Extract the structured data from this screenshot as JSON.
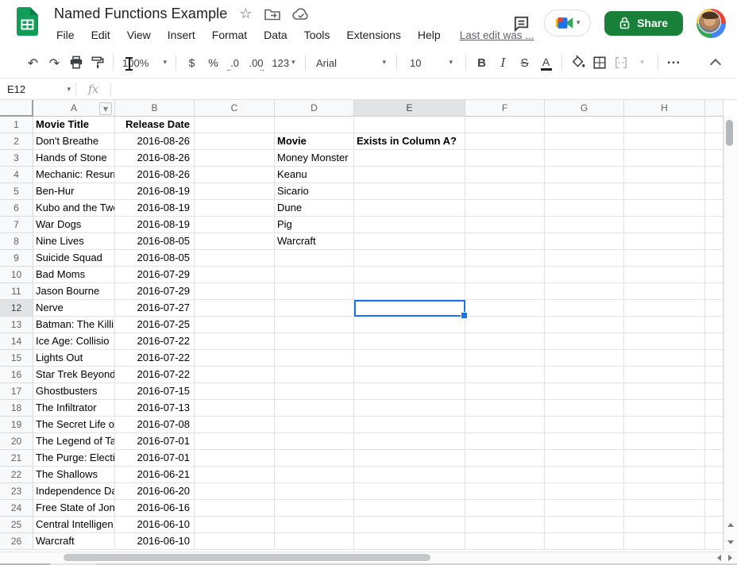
{
  "header": {
    "title": "Named Functions Example",
    "menus": [
      "File",
      "Edit",
      "View",
      "Insert",
      "Format",
      "Data",
      "Tools",
      "Extensions",
      "Help"
    ],
    "last_edit": "Last edit was ...",
    "share_label": "Share"
  },
  "toolbar": {
    "zoom": "100%",
    "currency": "$",
    "percent": "%",
    "decrease_decimal": ".0",
    "increase_decimal": ".00",
    "number_format": "123",
    "font_name": "Arial",
    "font_size": "10",
    "bold": "B",
    "italic": "I",
    "strikethrough": "S",
    "text_color": "A",
    "more": "..."
  },
  "formula_bar": {
    "name_box": "E12",
    "fx": "fx",
    "formula": ""
  },
  "icons": {
    "undo": "↶",
    "redo": "↷",
    "caret": "▾",
    "star": "☆",
    "left_arrow": "←",
    "right_arrow": "→",
    "filter_caret": "▼"
  },
  "colors": {
    "accent_blue": "#1a73e8",
    "logo_green": "#0f9d58",
    "share_green": "#188038"
  },
  "grid": {
    "columns": [
      "A",
      "B",
      "C",
      "D",
      "E",
      "F",
      "G",
      "H"
    ],
    "selected_cell": "E12",
    "selected_row": "12",
    "selected_col": "E",
    "rows": [
      {
        "n": "1",
        "a": "Movie Title",
        "b": "Release Date",
        "d": "",
        "e": "",
        "bold": [
          "a",
          "b"
        ]
      },
      {
        "n": "2",
        "a": "Don't Breathe",
        "b": "2016-08-26",
        "d": "Movie",
        "e": "Exists in Column A?",
        "bold": [
          "d",
          "e"
        ]
      },
      {
        "n": "3",
        "a": "Hands of Stone",
        "b": "2016-08-26",
        "d": "Money Monster",
        "e": "",
        "bold": []
      },
      {
        "n": "4",
        "a": "Mechanic: Resurr",
        "b": "2016-08-26",
        "d": "Keanu",
        "e": "",
        "bold": []
      },
      {
        "n": "5",
        "a": "Ben-Hur",
        "b": "2016-08-19",
        "d": "Sicario",
        "e": "",
        "bold": []
      },
      {
        "n": "6",
        "a": "Kubo and the Two",
        "b": "2016-08-19",
        "d": "Dune",
        "e": "",
        "bold": []
      },
      {
        "n": "7",
        "a": "War Dogs",
        "b": "2016-08-19",
        "d": "Pig",
        "e": "",
        "bold": []
      },
      {
        "n": "8",
        "a": "Nine Lives",
        "b": "2016-08-05",
        "d": "Warcraft",
        "e": "",
        "bold": []
      },
      {
        "n": "9",
        "a": "Suicide Squad",
        "b": "2016-08-05",
        "d": "",
        "e": "",
        "bold": []
      },
      {
        "n": "10",
        "a": "Bad Moms",
        "b": "2016-07-29",
        "d": "",
        "e": "",
        "bold": []
      },
      {
        "n": "11",
        "a": "Jason Bourne",
        "b": "2016-07-29",
        "d": "",
        "e": "",
        "bold": []
      },
      {
        "n": "12",
        "a": "Nerve",
        "b": "2016-07-27",
        "d": "",
        "e": "",
        "bold": []
      },
      {
        "n": "13",
        "a": "Batman: The Killi",
        "b": "2016-07-25",
        "d": "",
        "e": "",
        "bold": []
      },
      {
        "n": "14",
        "a": "Ice Age: Collisio",
        "b": "2016-07-22",
        "d": "",
        "e": "",
        "bold": []
      },
      {
        "n": "15",
        "a": "Lights Out",
        "b": "2016-07-22",
        "d": "",
        "e": "",
        "bold": []
      },
      {
        "n": "16",
        "a": "Star Trek Beyond",
        "b": "2016-07-22",
        "d": "",
        "e": "",
        "bold": []
      },
      {
        "n": "17",
        "a": "Ghostbusters",
        "b": "2016-07-15",
        "d": "",
        "e": "",
        "bold": []
      },
      {
        "n": "18",
        "a": "The Infiltrator",
        "b": "2016-07-13",
        "d": "",
        "e": "",
        "bold": []
      },
      {
        "n": "19",
        "a": "The Secret Life o",
        "b": "2016-07-08",
        "d": "",
        "e": "",
        "bold": []
      },
      {
        "n": "20",
        "a": "The Legend of Ta",
        "b": "2016-07-01",
        "d": "",
        "e": "",
        "bold": []
      },
      {
        "n": "21",
        "a": "The Purge: Electi",
        "b": "2016-07-01",
        "d": "",
        "e": "",
        "bold": []
      },
      {
        "n": "22",
        "a": "The Shallows",
        "b": "2016-06-21",
        "d": "",
        "e": "",
        "bold": []
      },
      {
        "n": "23",
        "a": "Independence Da",
        "b": "2016-06-20",
        "d": "",
        "e": "",
        "bold": []
      },
      {
        "n": "24",
        "a": "Free State of Jon",
        "b": "2016-06-16",
        "d": "",
        "e": "",
        "bold": []
      },
      {
        "n": "25",
        "a": "Central Intelligen",
        "b": "2016-06-10",
        "d": "",
        "e": "",
        "bold": []
      },
      {
        "n": "26",
        "a": "Warcraft",
        "b": "2016-06-10",
        "d": "",
        "e": "",
        "bold": []
      }
    ]
  }
}
